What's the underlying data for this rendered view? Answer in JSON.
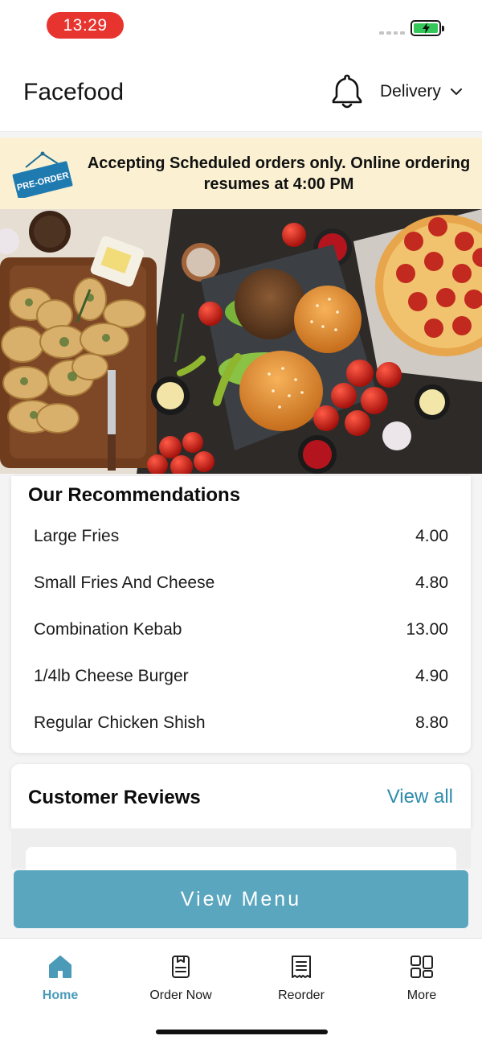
{
  "status_bar": {
    "time": "13:29"
  },
  "header": {
    "app_title": "Facefood",
    "mode_label": "Delivery"
  },
  "banner": {
    "tag": "PRE-ORDER",
    "message": "Accepting Scheduled orders only. Online ordering resumes at 4:00 PM"
  },
  "recommendations": {
    "title": "Our Recommendations",
    "items": [
      {
        "name": "Large Fries",
        "price": "4.00"
      },
      {
        "name": "Small Fries And Cheese",
        "price": "4.80"
      },
      {
        "name": "Combination Kebab",
        "price": "13.00"
      },
      {
        "name": "1/4lb Cheese Burger",
        "price": "4.90"
      },
      {
        "name": "Regular Chicken Shish",
        "price": "8.80"
      }
    ]
  },
  "reviews": {
    "title": "Customer Reviews",
    "view_all": "View all"
  },
  "cta": {
    "label": "View Menu"
  },
  "tabs": [
    {
      "label": "Home",
      "icon": "home-icon",
      "active": true
    },
    {
      "label": "Order Now",
      "icon": "order-icon",
      "active": false
    },
    {
      "label": "Reorder",
      "icon": "receipt-icon",
      "active": false
    },
    {
      "label": "More",
      "icon": "grid-icon",
      "active": false
    }
  ],
  "colors": {
    "accent": "#5ba6bf",
    "link": "#2f8cad",
    "banner_bg": "#fbf1d2",
    "time_pill": "#e8342f",
    "active_tab": "#4a9ab8"
  }
}
